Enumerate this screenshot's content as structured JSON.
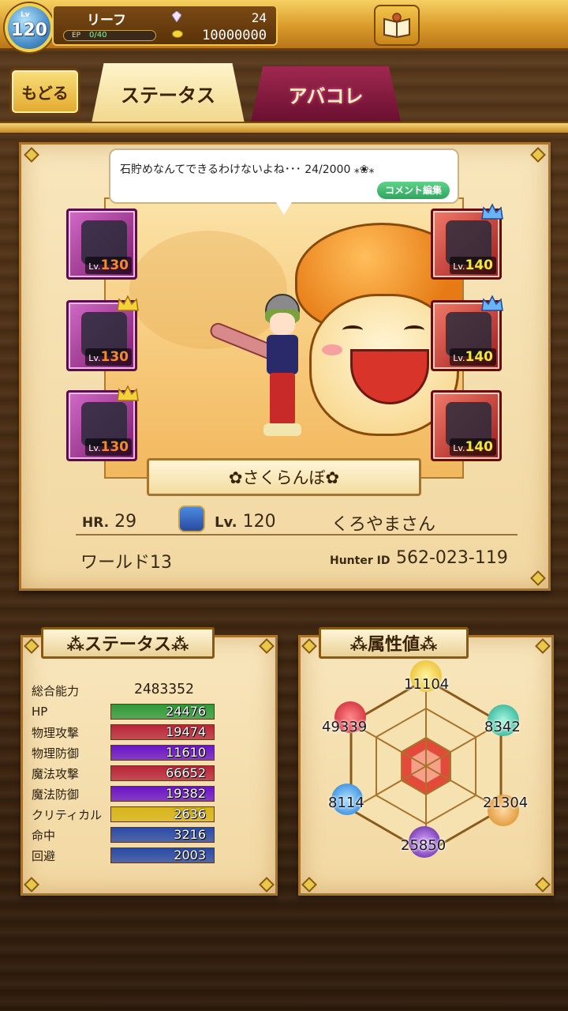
{
  "header": {
    "level_label": "Lv",
    "level": "120",
    "player_name": "リーフ",
    "ep_label": "EP",
    "ep_value": "0/40",
    "gems": "24",
    "coins": "10000000"
  },
  "nav": {
    "back_label": "もどる",
    "tab_status": "ステータス",
    "tab_abakore": "アバコレ"
  },
  "profile": {
    "comment": "石貯めなんてできるわけないよね･･･ 24/2000 ⁎❀⁎",
    "comment_edit_label": "コメント編集",
    "title": "✿さくらんぼ✿",
    "hr_key": "HR.",
    "hr_value": "29",
    "lv_key": "Lv.",
    "lv_value": "120",
    "name": "くろやまさん",
    "world": "ワールド13",
    "hunter_id_key": "Hunter ID",
    "hunter_id": "562-023-119"
  },
  "equipment": {
    "left": [
      {
        "level_prefix": "Lv.",
        "level": "130",
        "crown": false
      },
      {
        "level_prefix": "Lv.",
        "level": "130",
        "crown": true
      },
      {
        "level_prefix": "Lv.",
        "level": "130",
        "crown": true
      }
    ],
    "right": [
      {
        "level_prefix": "Lv.",
        "level": "140",
        "crown": true
      },
      {
        "level_prefix": "Lv.",
        "level": "140",
        "crown": true
      },
      {
        "level_prefix": "Lv.",
        "level": "140",
        "crown": false
      }
    ]
  },
  "status": {
    "title": "⁂ステータス⁂",
    "total_label": "総合能力",
    "total_value": "2483352",
    "rows": [
      {
        "label": "HP",
        "value": "24476",
        "color": "#2e9a3a"
      },
      {
        "label": "物理攻撃",
        "value": "19474",
        "color": "#b8263a"
      },
      {
        "label": "物理防御",
        "value": "11610",
        "color": "#6a14c8"
      },
      {
        "label": "魔法攻撃",
        "value": "66652",
        "color": "#b8263a"
      },
      {
        "label": "魔法防御",
        "value": "19382",
        "color": "#6a14c8"
      },
      {
        "label": "クリティカル",
        "value": "2636",
        "color": "#d8b41a"
      },
      {
        "label": "命中",
        "value": "3216",
        "color": "#2a4aa8"
      },
      {
        "label": "回避",
        "value": "2003",
        "color": "#2a4aa8"
      }
    ]
  },
  "attributes": {
    "title": "⁂属性値⁂",
    "top": "11104",
    "upper_left": "49339",
    "upper_right": "8342",
    "lower_left": "8114",
    "lower_right": "21304",
    "bottom": "25850"
  }
}
